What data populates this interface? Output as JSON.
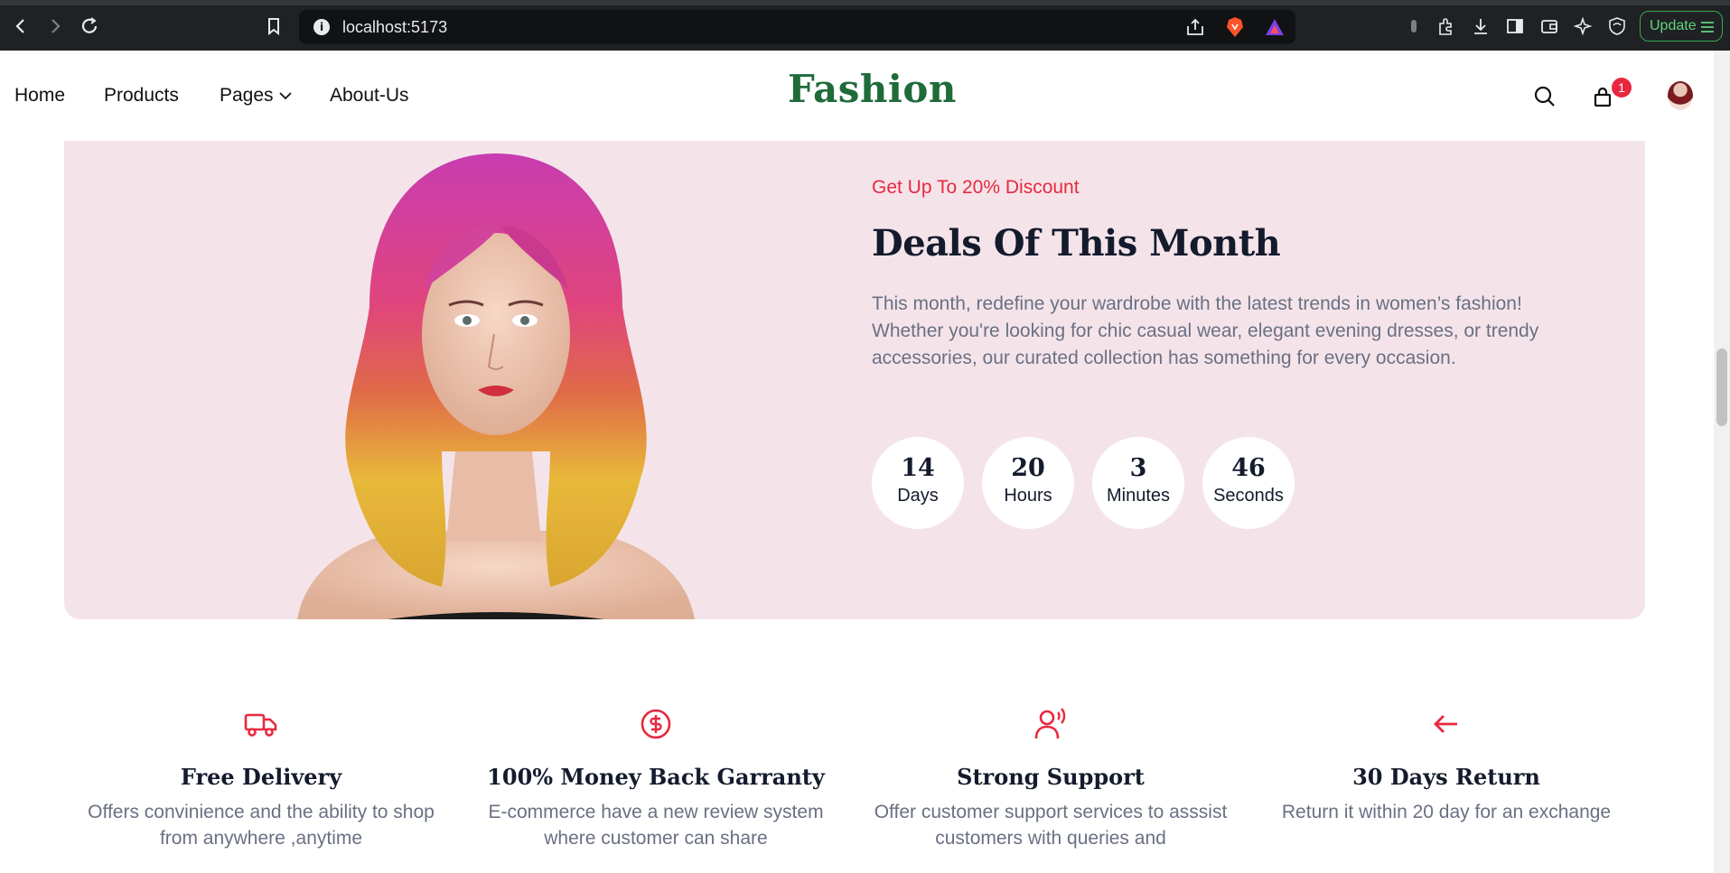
{
  "browser": {
    "url": "localhost:5173",
    "update_label": "Update"
  },
  "header": {
    "nav": [
      "Home",
      "Products",
      "Pages",
      "About-Us"
    ],
    "brand": "Fashion",
    "cart_count": "1"
  },
  "deals": {
    "discount": "Get Up To 20% Discount",
    "title": "Deals Of This Month",
    "description": "This month, redefine your wardrobe with the latest trends in women’s fashion! Whether you're looking for chic casual wear, elegant evening dresses, or trendy accessories, our curated collection has something for every occasion.",
    "countdown": [
      {
        "value": "14",
        "label": "Days"
      },
      {
        "value": "20",
        "label": "Hours"
      },
      {
        "value": "3",
        "label": "Minutes"
      },
      {
        "value": "46",
        "label": "Seconds"
      }
    ]
  },
  "features": [
    {
      "icon": "truck-icon",
      "title": "Free Delivery",
      "description": "Offers convinience and the ability to shop from anywhere ,anytime"
    },
    {
      "icon": "dollar-icon",
      "title": "100% Money Back Garranty",
      "description": "E-commerce have a new review system where customer can share"
    },
    {
      "icon": "support-icon",
      "title": "Strong Support",
      "description": "Offer customer support services to asssist customers with queries and"
    },
    {
      "icon": "arrow-left-icon",
      "title": "30 Days Return",
      "description": "Return it within 20 day for an exchange"
    }
  ],
  "colors": {
    "accent": "#e8283f",
    "brand": "#1f6b3a",
    "deals_bg": "#f4e4ea",
    "heading": "#141b2d",
    "muted": "#6a7083"
  }
}
